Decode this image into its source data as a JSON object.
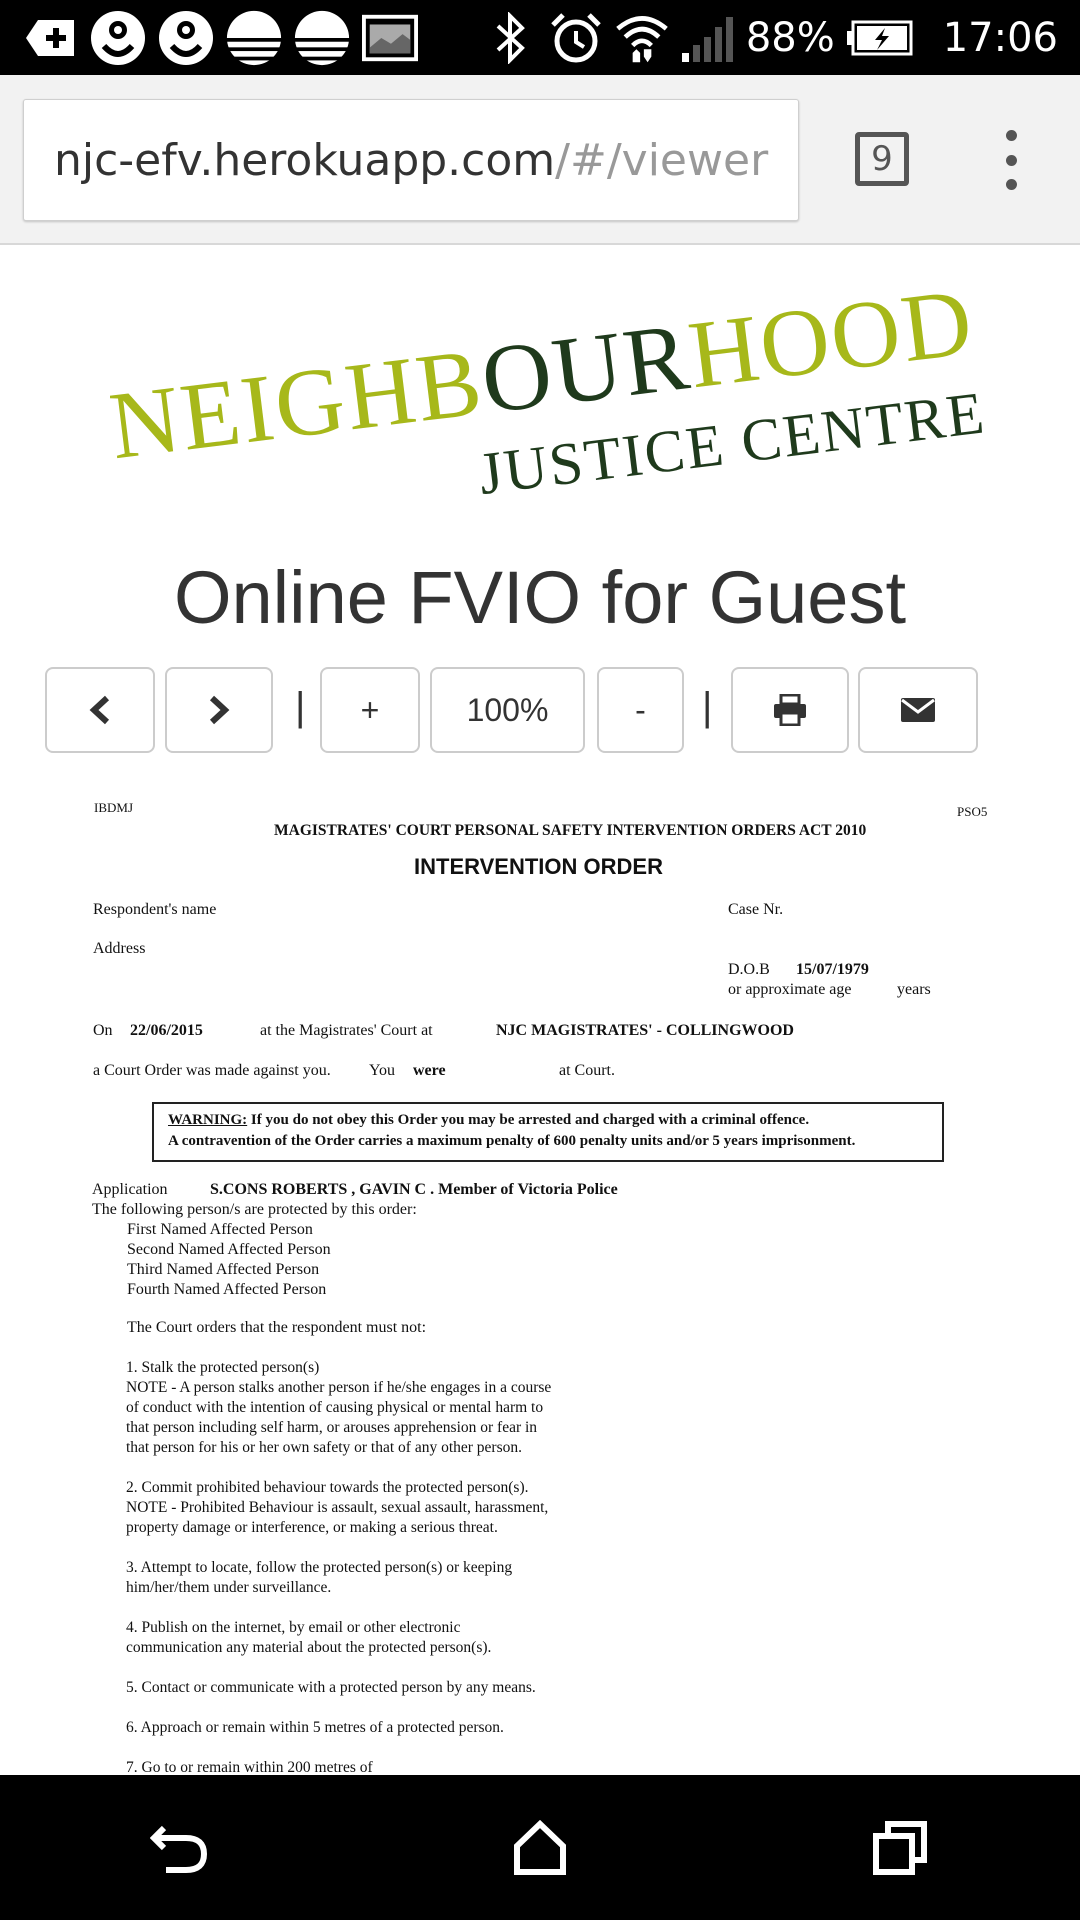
{
  "status_bar": {
    "battery_percent": "88%",
    "time": "17:06",
    "icons": [
      "add-notification-icon",
      "app-g-icon",
      "app-g-icon",
      "app-stripes-icon",
      "app-stripes-icon",
      "gallery-icon",
      "bluetooth-icon",
      "alarm-icon",
      "wifi-icon",
      "signal-icon",
      "battery-charging-icon"
    ]
  },
  "browser": {
    "url_host": "njc-efv.herokuapp.com",
    "url_path": "/#/viewer",
    "tab_count": "9"
  },
  "logo": {
    "line1": "NEIGHBOURHOOD",
    "line1_part_a": "NEIGHB",
    "line1_part_b": "OUR",
    "line1_part_c": "HOOD",
    "line2": "JUSTICE CENTRE",
    "colors": {
      "lime": "#a7b81a",
      "dark_green": "#1f3a1c"
    }
  },
  "page_title": "Online FVIO for Guest",
  "toolbar": {
    "prev_icon": "chevron-left-icon",
    "next_icon": "chevron-right-icon",
    "separator": "|",
    "zoom_in_label": "+",
    "zoom_level": "100%",
    "zoom_out_label": "-",
    "print_icon": "print-icon",
    "email_icon": "envelope-icon"
  },
  "document": {
    "corner_left": "IBDMJ",
    "corner_right": "PSO5",
    "act_title": "MAGISTRATES'  COURT PERSONAL SAFETY INTERVENTION ORDERS ACT 2010",
    "order_title": "INTERVENTION ORDER",
    "respondent_label": "Respondent's name",
    "case_label": "Case Nr.",
    "address_label": "Address",
    "dob_label": "D.O.B",
    "dob_value": "15/07/1979",
    "age_label": "or approximate age",
    "years_label": "years",
    "on_label": "On",
    "order_date": "22/06/2015",
    "court_at_label": "at the Magistrates' Court at",
    "court_name": "NJC MAGISTRATES' - COLLINGWOOD",
    "court_order_text": "a Court Order was made against you.",
    "you_label": "You",
    "were_label": "were",
    "at_court_label": "at Court.",
    "warning_label": "WARNING:",
    "warning_line1": "If you do not obey this Order you may be arrested and charged with a criminal offence.",
    "warning_line2": "A contravention of the Order carries a maximum penalty of 600 penalty units and/or 5 years imprisonment.",
    "application_label": "Application",
    "applicant": "S.CONS ROBERTS , GAVIN C . Member of Victoria Police",
    "protected_intro": "The following person/s are protected by this order:",
    "affected_persons": [
      "First Named Affected Person",
      "Second Named Affected Person",
      "Third Named Affected Person",
      "Fourth Named Affected Person"
    ],
    "orders_intro": "The Court orders that the respondent must not:",
    "orders": [
      "1. Stalk the protected person(s)",
      "NOTE - A person stalks another person if he/she engages in a course",
      "of conduct with the intention of causing physical or mental harm to",
      "that person including self harm, or arouses apprehension or fear in",
      "that person for his or her own safety or that of any other person.",
      "2. Commit prohibited behaviour towards the protected person(s).",
      "NOTE - Prohibited Behaviour is assault, sexual assault, harassment,",
      "property damage or interference, or making a serious threat.",
      "3. Attempt to locate, follow the protected person(s) or keeping",
      "him/her/them under surveillance.",
      "4. Publish on the internet, by email or other electronic",
      "communication any material about the protected person(s).",
      "5. Contact or communicate with a protected person by any means.",
      "6. Approach or remain within 5 metres of a protected person.",
      "7. Go to or remain within 200 metres of"
    ]
  },
  "nav_bar": {
    "icons": [
      "back-icon",
      "home-icon",
      "recents-icon"
    ]
  }
}
